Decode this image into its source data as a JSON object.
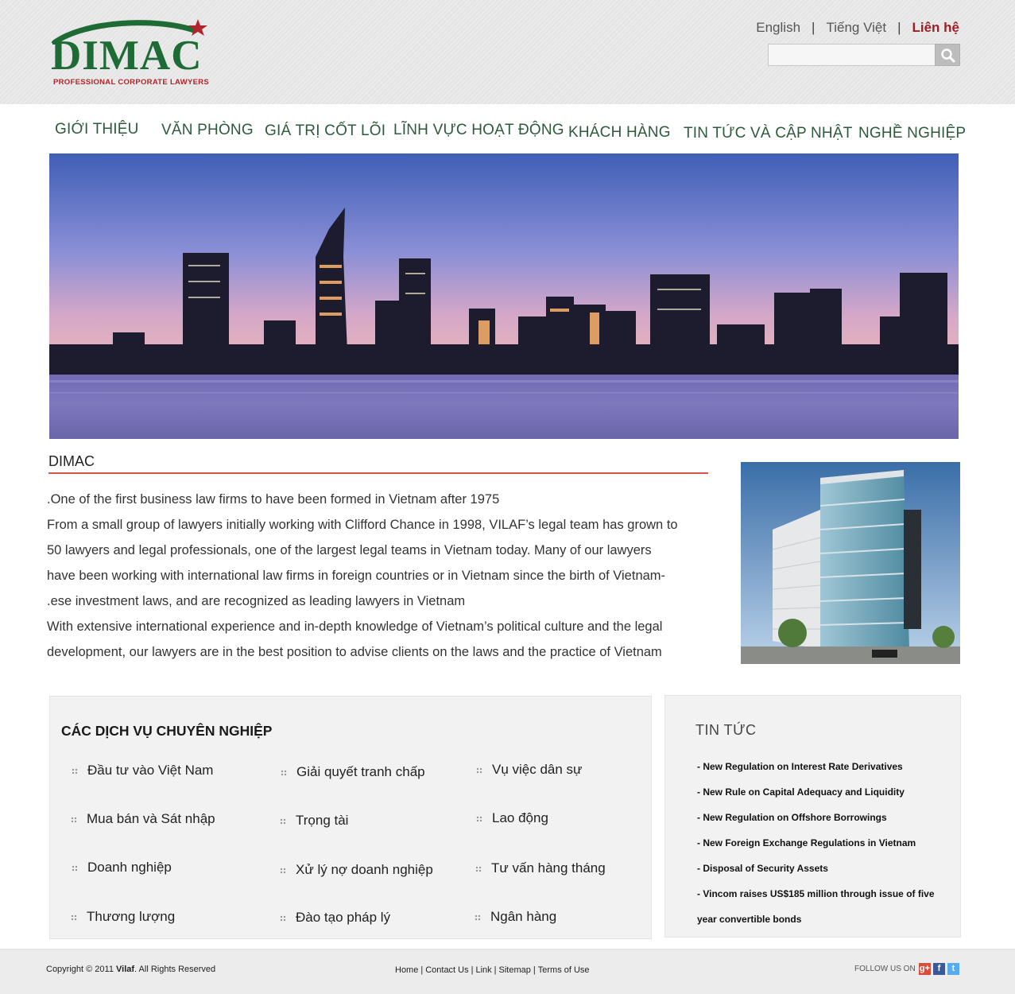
{
  "header": {
    "logo": {
      "brand": "DIMAC",
      "tagline": "PROFESSIONAL CORPORATE LAWYERS"
    },
    "lang": {
      "english": "English",
      "separator": "|",
      "vietnamese": "Tiếng Việt",
      "contact": "Liên hệ"
    },
    "search": {
      "placeholder": "",
      "icon": "search-icon"
    }
  },
  "nav": {
    "items": [
      "GIỚI THIỆU",
      "VĂN PHÒNG",
      "GIÁ TRỊ CỐT LÕI",
      "LĨNH VỰC HOẠT ĐỘNG",
      "KHÁCH HÀNG",
      "TIN TỨC VÀ CẬP NHẬT",
      "NGHỀ NGHIỆP"
    ]
  },
  "intro": {
    "title": "DIMAC",
    "lines": [
      ".One of the first business law firms to have been formed in Vietnam after 1975",
      "From a small group of lawyers initially working with Clifford Chance in 1998, VILAF’s legal team has grown to",
      "50 lawyers and legal professionals, one of the largest legal teams in Vietnam today.  Many of our lawyers",
      "have been working with international law firms in foreign countries or in Vietnam since the birth of Vietnam-",
      ".ese investment laws, and are recognized as leading lawyers in Vietnam",
      "With extensive international experience and in-depth knowledge of Vietnam’s political culture and the legal",
      "development, our lawyers are in the best position to advise clients on the laws and the practice of Vietnam"
    ]
  },
  "services": {
    "title": "CÁC DỊCH VỤ CHUYÊN NGHIỆP",
    "items": [
      "Đầu tư vào Việt Nam",
      "Giải quyết tranh chấp",
      "Vụ việc dân sự",
      "Mua bán và Sát nhập",
      "Trọng tài",
      "Lao động",
      "Doanh nghiệp",
      "Xử lý nợ doanh nghiệp",
      "Tư vấn hàng tháng",
      "Thương lượng",
      "Đào tạo pháp lý",
      "Ngân hàng"
    ]
  },
  "news": {
    "title": "TIN TỨC",
    "items": [
      "- New Regulation on Interest Rate Derivatives",
      "- New Rule on Capital Adequacy and Liquidity",
      "- New Regulation on Offshore Borrowings",
      "- New Foreign Exchange Regulations in Vietnam",
      "- Disposal of Security Assets",
      "- Vincom raises US$185 million through issue of five",
      "year  convertible bonds"
    ]
  },
  "footer": {
    "copyright_prefix": "Copyright © 2011 ",
    "copyright_brand": "Vilaf",
    "copyright_suffix": ". All Rights Reserved",
    "links": [
      "Home",
      "Contact Us",
      "Link",
      "Sitemap",
      "Terms of Use"
    ],
    "link_separator": "|",
    "follow": "FOLLOW US ON",
    "social": [
      {
        "name": "google-plus",
        "glyph": "g+",
        "color": "#dd4b39"
      },
      {
        "name": "facebook",
        "glyph": "f",
        "color": "#3b5998"
      },
      {
        "name": "twitter",
        "glyph": "t",
        "color": "#55acee"
      }
    ]
  },
  "colors": {
    "brand_green": "#1f6b35",
    "brand_red": "#b0252b",
    "nav_text": "#2d5a3a",
    "rule_red": "#d9534f"
  }
}
